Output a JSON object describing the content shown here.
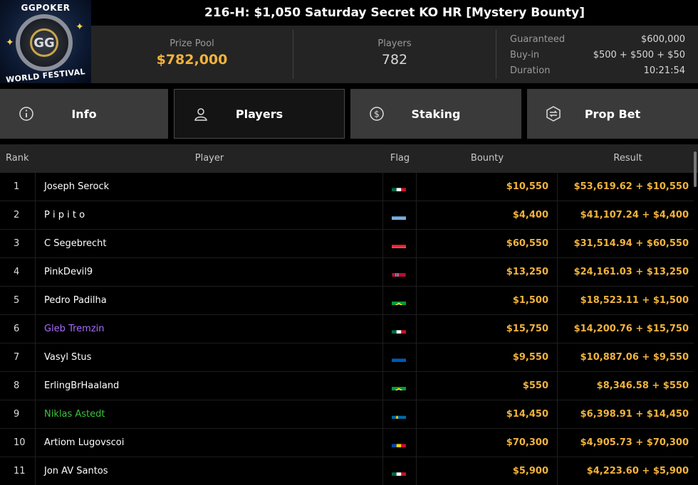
{
  "logo": {
    "top_text": "GGPOKER",
    "mark": "GG",
    "bottom_text": "WORLD FESTIVAL"
  },
  "tournament": {
    "title": "216-H: $1,050 Saturday Secret KO HR [Mystery Bounty]"
  },
  "stats": {
    "prize_pool_label": "Prize Pool",
    "prize_pool": "$782,000",
    "players_label": "Players",
    "players": "782",
    "guaranteed_label": "Guaranteed",
    "guaranteed": "$600,000",
    "buyin_label": "Buy-in",
    "buyin": "$500 + $500 + $50",
    "duration_label": "Duration",
    "duration": "10:21:54"
  },
  "tabs": [
    {
      "label": "Info",
      "icon": "info-icon",
      "active": false
    },
    {
      "label": "Players",
      "icon": "user-icon",
      "active": true
    },
    {
      "label": "Staking",
      "icon": "dollar-coin-icon",
      "active": false
    },
    {
      "label": "Prop Bet",
      "icon": "prop-bet-icon",
      "active": false
    }
  ],
  "table": {
    "headers": {
      "rank": "Rank",
      "player": "Player",
      "flag": "Flag",
      "bounty": "Bounty",
      "result": "Result"
    },
    "rows": [
      {
        "rank": "1",
        "player": "Joseph Serock",
        "name_color": "#ffffff",
        "flag": "mexico",
        "bounty": "$10,550",
        "result": "$53,619.62 + $10,550"
      },
      {
        "rank": "2",
        "player": "P i p i t o",
        "name_color": "#ffffff",
        "flag": "argentina",
        "bounty": "$4,400",
        "result": "$41,107.24 + $4,400"
      },
      {
        "rank": "3",
        "player": "C Segebrecht",
        "name_color": "#ffffff",
        "flag": "austria",
        "bounty": "$60,550",
        "result": "$31,514.94 + $60,550"
      },
      {
        "rank": "4",
        "player": "PinkDevil9",
        "name_color": "#ffffff",
        "flag": "norway",
        "bounty": "$13,250",
        "result": "$24,161.03 + $13,250"
      },
      {
        "rank": "5",
        "player": "Pedro Padilha",
        "name_color": "#ffffff",
        "flag": "brazil",
        "bounty": "$1,500",
        "result": "$18,523.11 + $1,500"
      },
      {
        "rank": "6",
        "player": "Gleb Tremzin",
        "name_color": "#a86bff",
        "flag": "mexico",
        "bounty": "$15,750",
        "result": "$14,200.76 + $15,750"
      },
      {
        "rank": "7",
        "player": "Vasyl Stus",
        "name_color": "#ffffff",
        "flag": "ukraine",
        "bounty": "$9,550",
        "result": "$10,887.06 + $9,550"
      },
      {
        "rank": "8",
        "player": "ErlingBrHaaland",
        "name_color": "#ffffff",
        "flag": "brazil",
        "bounty": "$550",
        "result": "$8,346.58 + $550"
      },
      {
        "rank": "9",
        "player": "Niklas Astedt",
        "name_color": "#3cc43c",
        "flag": "sweden",
        "bounty": "$14,450",
        "result": "$6,398.91 + $14,450"
      },
      {
        "rank": "10",
        "player": "Artiom Lugovscoi",
        "name_color": "#ffffff",
        "flag": "moldova",
        "bounty": "$70,300",
        "result": "$4,905.73 + $70,300"
      },
      {
        "rank": "11",
        "player": "Jon AV Santos",
        "name_color": "#ffffff",
        "flag": "mexico",
        "bounty": "$5,900",
        "result": "$4,223.60 + $5,900"
      }
    ]
  },
  "colors": {
    "accent_gold": "#f2b33d",
    "panel": "#242424",
    "tab": "#3a3a3a"
  }
}
